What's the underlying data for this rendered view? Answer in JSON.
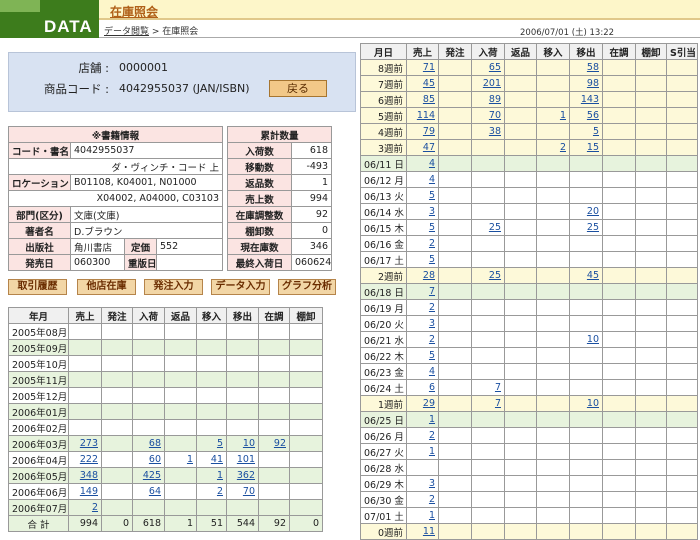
{
  "header": {
    "logo": "DATA",
    "title": "在庫照会",
    "crumb_link": "データ閲覧",
    "crumb_sep": " > ",
    "crumb_current": "在庫照会",
    "datetime": "2006/07/01 (土) 13:22"
  },
  "store": {
    "store_label": "店舗 :",
    "store_value": "0000001",
    "code_label": "商品コード :",
    "code_value": "4042955037  (JAN/ISBN)",
    "back": "戻る"
  },
  "book": {
    "title": "※書籍情報",
    "code_label": "コード・書名",
    "code": "4042955037",
    "name": "ダ・ヴィンチ・コード 上",
    "loc_label": "ロケーション",
    "loc1": "B01108, K04001, N01000",
    "loc2": "X04002, A04000, C03103",
    "cat_label": "部門(区分)",
    "cat": "文庫(文庫)",
    "author_label": "著者名",
    "author": "D.ブラウン",
    "pub_label": "出版社",
    "pub": "角川書店",
    "price_label": "定価",
    "price": "552",
    "date_label": "発売日",
    "date": "060300",
    "reissue_label": "重版日",
    "reissue": ""
  },
  "totals": {
    "title": "累計数量",
    "rows": [
      {
        "label": "入荷数",
        "value": "618"
      },
      {
        "label": "移動数",
        "value": "-493"
      },
      {
        "label": "返品数",
        "value": "1"
      },
      {
        "label": "売上数",
        "value": "994"
      },
      {
        "label": "在庫調整数",
        "value": "92"
      },
      {
        "label": "棚卸数",
        "value": "0"
      },
      {
        "label": "現在庫数",
        "value": "346"
      },
      {
        "label": "最終入荷日",
        "value": "060624"
      }
    ]
  },
  "buttons": [
    "取引履歴",
    "他店在庫",
    "発注入力",
    "データ入力",
    "グラフ分析"
  ],
  "monthly": {
    "headers": [
      "年月",
      "売上",
      "発注",
      "入荷",
      "返品",
      "移入",
      "移出",
      "在調",
      "棚卸"
    ],
    "rows": [
      [
        "2005年08月",
        "",
        "",
        "",
        "",
        "",
        "",
        "",
        ""
      ],
      [
        "2005年09月",
        "",
        "",
        "",
        "",
        "",
        "",
        "",
        ""
      ],
      [
        "2005年10月",
        "",
        "",
        "",
        "",
        "",
        "",
        "",
        ""
      ],
      [
        "2005年11月",
        "",
        "",
        "",
        "",
        "",
        "",
        "",
        ""
      ],
      [
        "2005年12月",
        "",
        "",
        "",
        "",
        "",
        "",
        "",
        ""
      ],
      [
        "2006年01月",
        "",
        "",
        "",
        "",
        "",
        "",
        "",
        ""
      ],
      [
        "2006年02月",
        "",
        "",
        "",
        "",
        "",
        "",
        "",
        ""
      ],
      [
        "2006年03月",
        "273",
        "",
        "68",
        "",
        "5",
        "10",
        "92",
        ""
      ],
      [
        "2006年04月",
        "222",
        "",
        "60",
        "1",
        "41",
        "101",
        "",
        ""
      ],
      [
        "2006年05月",
        "348",
        "",
        "425",
        "",
        "1",
        "362",
        "",
        ""
      ],
      [
        "2006年06月",
        "149",
        "",
        "64",
        "",
        "2",
        "70",
        "",
        ""
      ],
      [
        "2006年07月",
        "2",
        "",
        "",
        "",
        "",
        "",
        "",
        ""
      ]
    ],
    "total": [
      "合 計",
      "994",
      "0",
      "618",
      "1",
      "51",
      "544",
      "92",
      "0"
    ]
  },
  "daily": {
    "headers": [
      "月日",
      "売上",
      "発注",
      "入荷",
      "返品",
      "移入",
      "移出",
      "在調",
      "棚卸",
      "S引当"
    ],
    "rows": [
      [
        "8週前",
        "71",
        "",
        "65",
        "",
        "",
        "58",
        "",
        "",
        ""
      ],
      [
        "7週前",
        "45",
        "",
        "201",
        "",
        "",
        "98",
        "",
        "",
        ""
      ],
      [
        "6週前",
        "85",
        "",
        "89",
        "",
        "",
        "143",
        "",
        "",
        ""
      ],
      [
        "5週前",
        "114",
        "",
        "70",
        "",
        "1",
        "56",
        "",
        "",
        ""
      ],
      [
        "4週前",
        "79",
        "",
        "38",
        "",
        "",
        "5",
        "",
        "",
        ""
      ],
      [
        "3週前",
        "47",
        "",
        "",
        "",
        "2",
        "15",
        "",
        "",
        ""
      ],
      [
        "06/11 日",
        "4",
        "",
        "",
        "",
        "",
        "",
        "",
        "",
        ""
      ],
      [
        "06/12 月",
        "4",
        "",
        "",
        "",
        "",
        "",
        "",
        "",
        ""
      ],
      [
        "06/13 火",
        "5",
        "",
        "",
        "",
        "",
        "",
        "",
        "",
        ""
      ],
      [
        "06/14 水",
        "3",
        "",
        "",
        "",
        "",
        "20",
        "",
        "",
        ""
      ],
      [
        "06/15 木",
        "5",
        "",
        "25",
        "",
        "",
        "25",
        "",
        "",
        ""
      ],
      [
        "06/16 金",
        "2",
        "",
        "",
        "",
        "",
        "",
        "",
        "",
        ""
      ],
      [
        "06/17 土",
        "5",
        "",
        "",
        "",
        "",
        "",
        "",
        "",
        ""
      ],
      [
        "2週前",
        "28",
        "",
        "25",
        "",
        "",
        "45",
        "",
        "",
        ""
      ],
      [
        "06/18 日",
        "7",
        "",
        "",
        "",
        "",
        "",
        "",
        "",
        ""
      ],
      [
        "06/19 月",
        "2",
        "",
        "",
        "",
        "",
        "",
        "",
        "",
        ""
      ],
      [
        "06/20 火",
        "3",
        "",
        "",
        "",
        "",
        "",
        "",
        "",
        ""
      ],
      [
        "06/21 水",
        "2",
        "",
        "",
        "",
        "",
        "10",
        "",
        "",
        ""
      ],
      [
        "06/22 木",
        "5",
        "",
        "",
        "",
        "",
        "",
        "",
        "",
        ""
      ],
      [
        "06/23 金",
        "4",
        "",
        "",
        "",
        "",
        "",
        "",
        "",
        ""
      ],
      [
        "06/24 土",
        "6",
        "",
        "7",
        "",
        "",
        "",
        "",
        "",
        ""
      ],
      [
        "1週前",
        "29",
        "",
        "7",
        "",
        "",
        "10",
        "",
        "",
        ""
      ],
      [
        "06/25 日",
        "1",
        "",
        "",
        "",
        "",
        "",
        "",
        "",
        ""
      ],
      [
        "06/26 月",
        "2",
        "",
        "",
        "",
        "",
        "",
        "",
        "",
        ""
      ],
      [
        "06/27 火",
        "1",
        "",
        "",
        "",
        "",
        "",
        "",
        "",
        ""
      ],
      [
        "06/28 水",
        "",
        "",
        "",
        "",
        "",
        "",
        "",
        "",
        ""
      ],
      [
        "06/29 木",
        "3",
        "",
        "",
        "",
        "",
        "",
        "",
        "",
        ""
      ],
      [
        "06/30 金",
        "2",
        "",
        "",
        "",
        "",
        "",
        "",
        "",
        ""
      ],
      [
        "07/01 土",
        "1",
        "",
        "",
        "",
        "",
        "",
        "",
        "",
        ""
      ],
      [
        "0週前",
        "11",
        "",
        "",
        "",
        "",
        "",
        "",
        "",
        ""
      ]
    ]
  }
}
